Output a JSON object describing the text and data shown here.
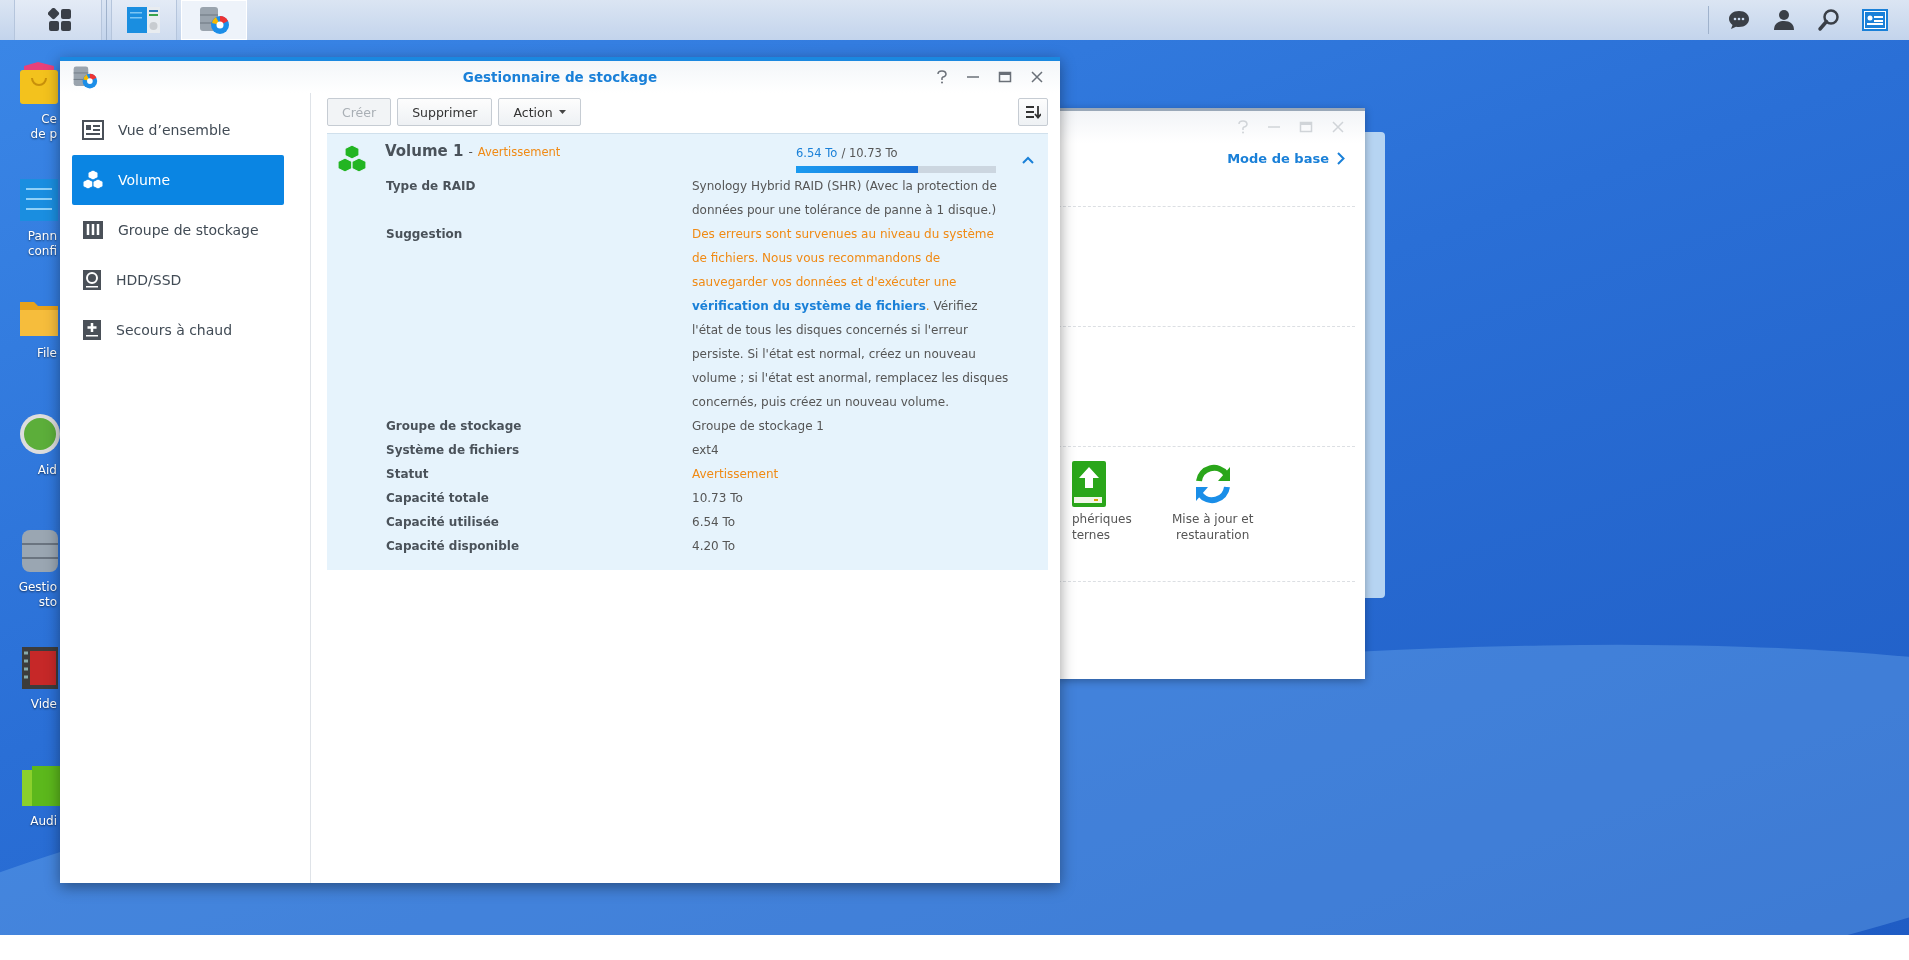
{
  "taskbar": {
    "apps": [
      {
        "kind": "panel",
        "selected": false
      },
      {
        "kind": "storage",
        "selected": true
      }
    ]
  },
  "desktop_icons": [
    {
      "kind": "store",
      "lines": [
        "Ce",
        "de p"
      ]
    },
    {
      "kind": "panel",
      "lines": [
        "Pann",
        "confi"
      ]
    },
    {
      "kind": "folder",
      "lines": [
        "File"
      ]
    },
    {
      "kind": "help",
      "lines": [
        "Aid"
      ]
    },
    {
      "kind": "storage",
      "lines": [
        "Gestio",
        "sto"
      ]
    },
    {
      "kind": "video",
      "lines": [
        "Vide"
      ]
    },
    {
      "kind": "audio",
      "lines": [
        "Audi"
      ]
    }
  ],
  "background_window": {
    "mode_link": "Mode de base",
    "items": [
      {
        "kind": "external",
        "lines": [
          "phériques",
          "ternes"
        ]
      },
      {
        "kind": "update",
        "lines": [
          "Mise à jour et",
          "restauration"
        ]
      }
    ]
  },
  "main_window": {
    "title": "Gestionnaire de stockage",
    "sidebar": [
      {
        "kind": "overview",
        "label": "Vue d’ensemble",
        "selected": false
      },
      {
        "kind": "volume",
        "label": "Volume",
        "selected": true
      },
      {
        "kind": "pool",
        "label": "Groupe de stockage",
        "selected": false
      },
      {
        "kind": "disk",
        "label": "HDD/SSD",
        "selected": false
      },
      {
        "kind": "hotspare",
        "label": "Secours à chaud",
        "selected": false
      }
    ],
    "toolbar": [
      {
        "kind": "button",
        "label": "Créer",
        "disabled": true
      },
      {
        "kind": "button",
        "label": "Supprimer",
        "disabled": false
      },
      {
        "kind": "dropdown",
        "label": "Action",
        "disabled": false
      }
    ],
    "volume": {
      "name": "Volume 1",
      "separator": "-",
      "status": "Avertissement",
      "used": "6.54 To",
      "total": "/ 10.73 To",
      "level": 0.61,
      "expanded": true,
      "details": [
        {
          "label": "Type de RAID",
          "kind": "plain",
          "value": "Synology Hybrid RAID (SHR) (Avec la protection de données pour une tolérance de panne à 1 disque.)"
        },
        {
          "label": "Suggestion",
          "kind": "segments",
          "segments": [
            {
              "kind": "warning",
              "text": "Des erreurs sont survenues au niveau du système de fichiers. Nous vous recommandons de sauvegarder vos données et d'exécuter une "
            },
            {
              "kind": "link",
              "text": "vérification du système de fichiers"
            },
            {
              "kind": "warning",
              "text": "."
            },
            {
              "kind": "plain",
              "text": " Vérifiez l'état de tous les disques concernés si l'erreur persiste. Si l'état est normal, créez un nouveau volume ; si l'état est anormal, remplacez les disques concernés, puis créez un nouveau volume."
            }
          ]
        },
        {
          "label": "Groupe de stockage",
          "kind": "plain",
          "value": "Groupe de stockage 1"
        },
        {
          "label": "Système de fichiers",
          "kind": "plain",
          "value": "ext4"
        },
        {
          "label": "Statut",
          "kind": "warning",
          "value": "Avertissement"
        },
        {
          "label": "Capacité totale",
          "kind": "plain",
          "value": "10.73 To"
        },
        {
          "label": "Capacité utilisée",
          "kind": "plain",
          "value": "6.54 To"
        },
        {
          "label": "Capacité disponible",
          "kind": "plain",
          "value": "4.20 To"
        }
      ]
    }
  }
}
